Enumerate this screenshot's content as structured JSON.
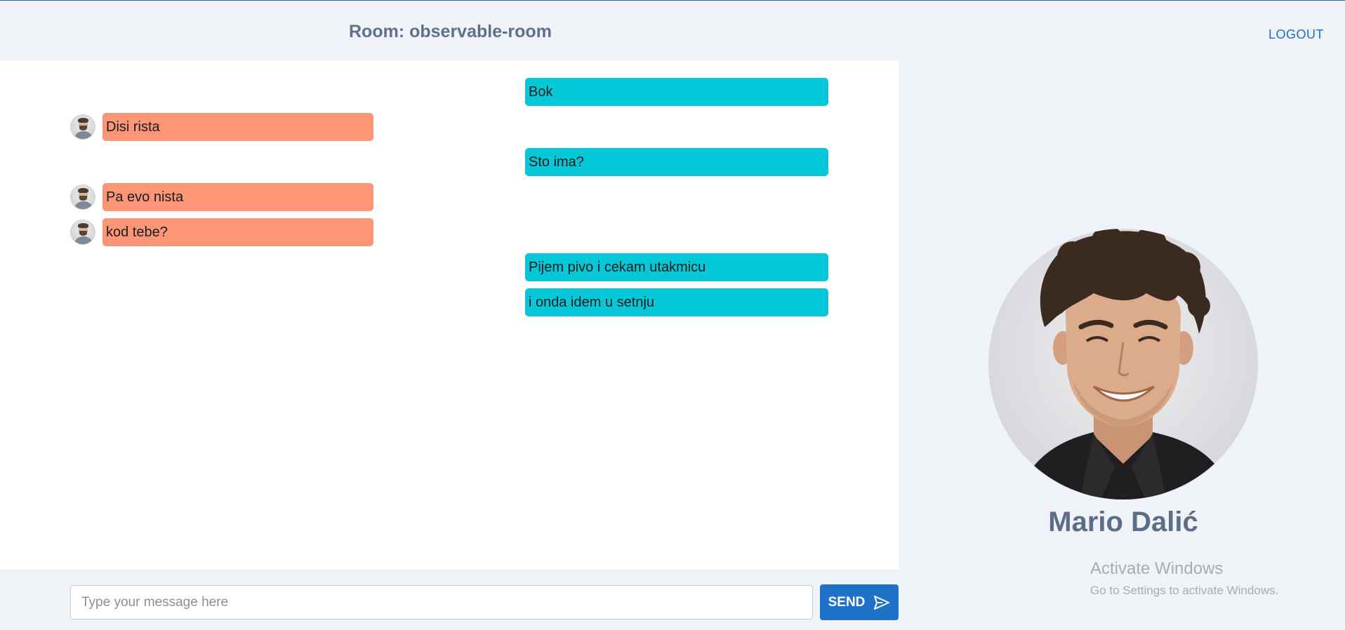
{
  "header": {
    "room_title": "Room: observable-room",
    "logout_label": "LOGOUT"
  },
  "messages": [
    {
      "side": "sent",
      "text": "Bok"
    },
    {
      "side": "received",
      "text": "Disi rista"
    },
    {
      "side": "sent",
      "text": "Sto ima?"
    },
    {
      "side": "received",
      "text": "Pa evo nista"
    },
    {
      "side": "received",
      "text": "kod tebe?"
    },
    {
      "side": "sent",
      "text": "Pijem pivo i cekam utakmicu"
    },
    {
      "side": "sent",
      "text": "i onda idem u setnju"
    }
  ],
  "composer": {
    "placeholder": "Type your message here",
    "value": "",
    "send_label": "SEND"
  },
  "profile": {
    "name": "Mario Dalić"
  },
  "watermark": {
    "title": "Activate Windows",
    "subtitle": "Go to Settings to activate Windows."
  },
  "colors": {
    "sent_bubble": "#04c8d8",
    "received_bubble": "#fd9577",
    "accent": "#1e72c8",
    "title_text": "#617089"
  }
}
